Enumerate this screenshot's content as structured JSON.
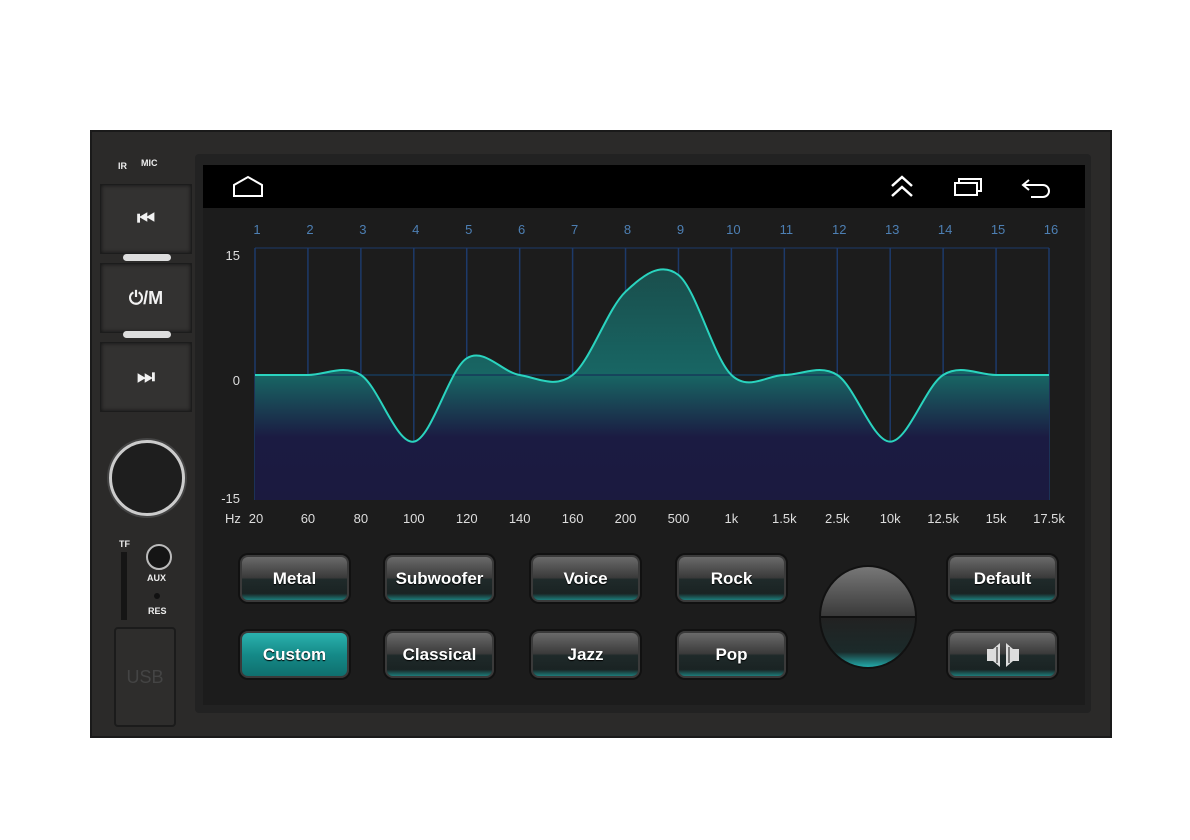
{
  "device": {
    "ir_label": "IR",
    "mic_label": "MIC",
    "power_mode_label": "⏻/M",
    "tf_label": "TF",
    "aux_label": "AUX",
    "res_label": "RES",
    "usb_label": "USB"
  },
  "nav": {
    "icons": [
      "home-icon",
      "double-chevron-up-icon",
      "recent-apps-icon",
      "back-icon"
    ]
  },
  "chart_data": {
    "type": "area",
    "band_labels": [
      "1",
      "2",
      "3",
      "4",
      "5",
      "6",
      "7",
      "8",
      "9",
      "10",
      "11",
      "12",
      "13",
      "14",
      "15",
      "16"
    ],
    "freq_unit": "Hz",
    "freq_labels": [
      "20",
      "60",
      "80",
      "100",
      "120",
      "140",
      "160",
      "200",
      "500",
      "1k",
      "1.5k",
      "2.5k",
      "10k",
      "12.5k",
      "15k",
      "17.5k"
    ],
    "values": [
      0,
      0,
      0,
      -8,
      2,
      0,
      0,
      10,
      12,
      0,
      0,
      0,
      -8,
      0,
      0,
      0
    ],
    "y_ticks": [
      "15",
      "0",
      "-15"
    ],
    "ylim": [
      -15,
      15
    ],
    "grid": true,
    "colors": {
      "line": "#2ad4bf",
      "fill_top": "#1a6b68",
      "fill_bottom": "#1b1a3f",
      "grid": "#1d3a6a"
    }
  },
  "presets": {
    "row1": [
      "Metal",
      "Subwoofer",
      "Voice",
      "Rock"
    ],
    "row2": [
      "Custom",
      "Classical",
      "Jazz",
      "Pop"
    ],
    "default_label": "Default",
    "active": "Custom",
    "accent": "#1aa6a3"
  }
}
